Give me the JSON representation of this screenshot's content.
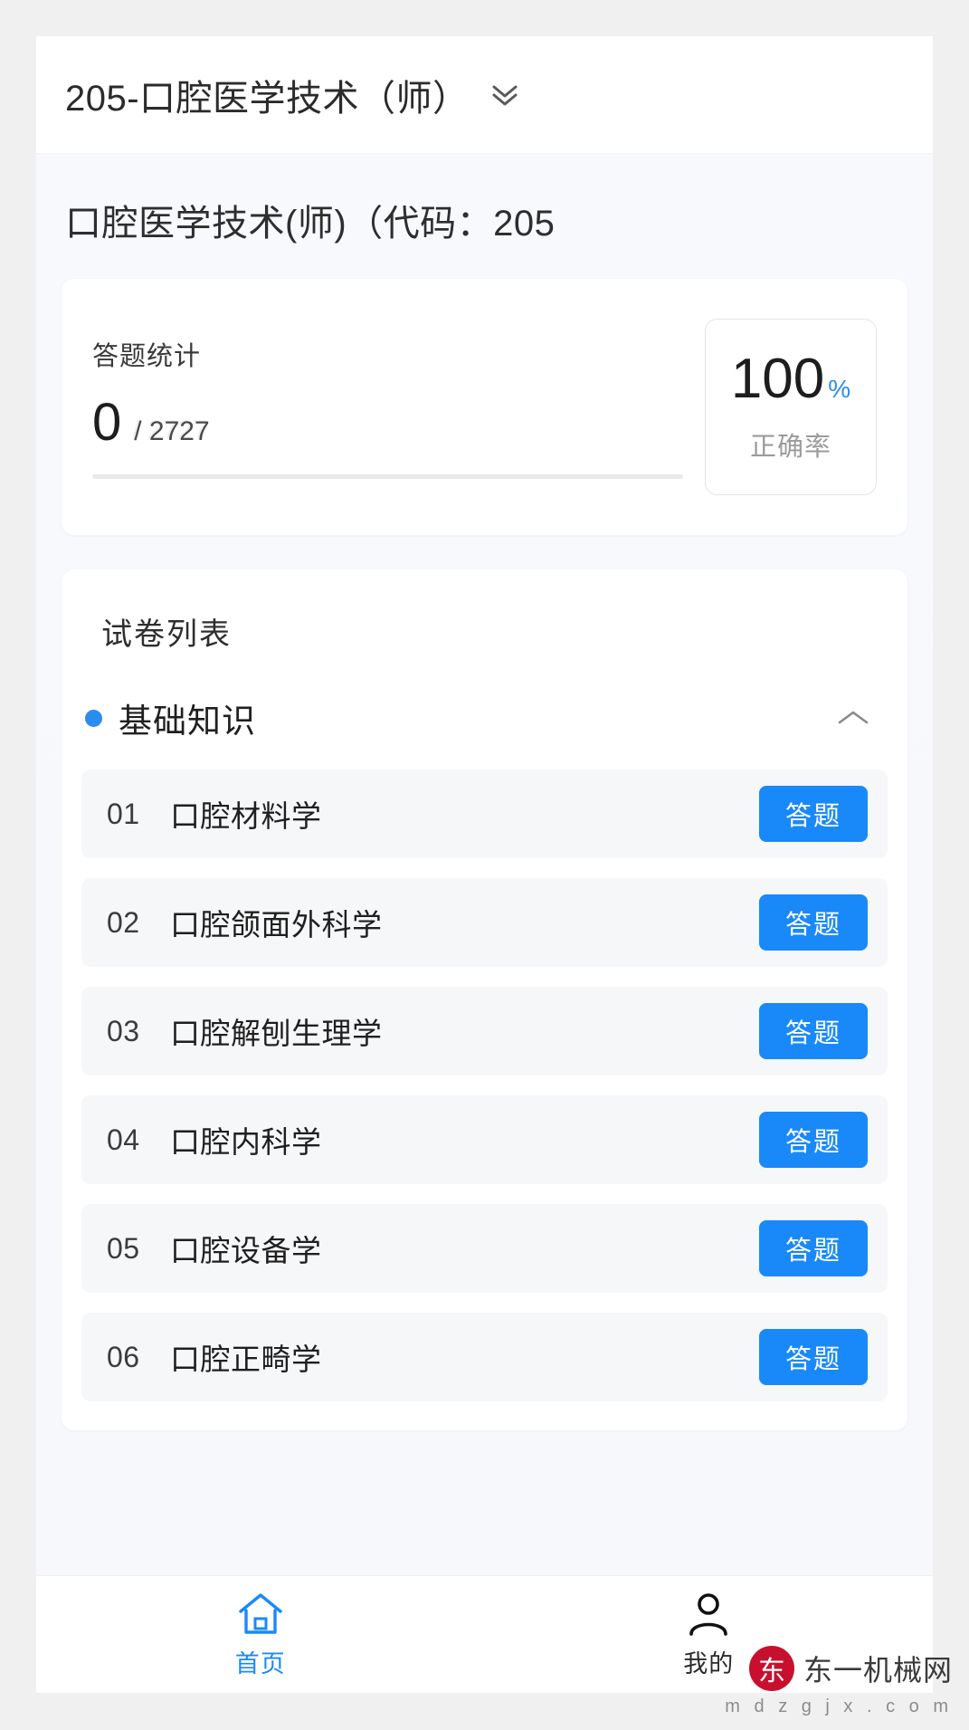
{
  "header": {
    "title": "205-口腔医学技术（师）",
    "dropdown_icon": "double-chevron-down-icon"
  },
  "subtitle": "口腔医学技术(师)（代码：205",
  "stats": {
    "label": "答题统计",
    "answered": "0",
    "total_text": "/ 2727",
    "total": 2727,
    "progress_percent": 0,
    "accuracy_value": "100",
    "accuracy_unit": "%",
    "accuracy_label": "正确率",
    "accent_color": "#1989fa"
  },
  "list": {
    "title": "试卷列表",
    "category": {
      "label": "基础知识",
      "dot_color": "#2b8cf0",
      "collapse_icon": "chevron-up-icon",
      "expanded": true
    },
    "action_label": "答题",
    "papers": [
      {
        "index": "01",
        "name": "口腔材料学"
      },
      {
        "index": "02",
        "name": "口腔颌面外科学"
      },
      {
        "index": "03",
        "name": "口腔解刨生理学"
      },
      {
        "index": "04",
        "name": "口腔内科学"
      },
      {
        "index": "05",
        "name": "口腔设备学"
      },
      {
        "index": "06",
        "name": "口腔正畸学"
      }
    ]
  },
  "tabbar": {
    "items": [
      {
        "label": "首页",
        "icon": "home-icon",
        "active": true
      },
      {
        "label": "我的",
        "icon": "person-icon",
        "active": false
      }
    ]
  },
  "watermark": {
    "mark": "东",
    "name": "东一机械网",
    "url": "m d z g j x . c o m",
    "badge_color": "#c8102e"
  }
}
